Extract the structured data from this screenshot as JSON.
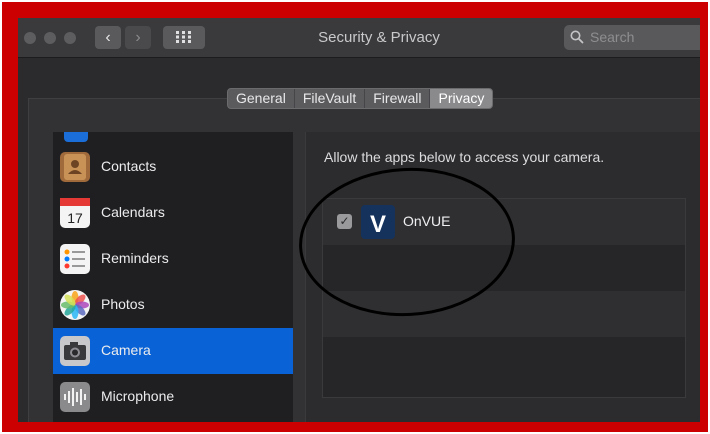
{
  "window": {
    "title": "Security & Privacy",
    "search_placeholder": "Search"
  },
  "tabs": [
    {
      "label": "General",
      "selected": false
    },
    {
      "label": "FileVault",
      "selected": false
    },
    {
      "label": "Firewall",
      "selected": false
    },
    {
      "label": "Privacy",
      "selected": true
    }
  ],
  "sidebar": {
    "items": [
      {
        "label": "Contacts",
        "icon": "contacts-icon",
        "selected": false
      },
      {
        "label": "Calendars",
        "icon": "calendar-icon",
        "icon_text": "17",
        "selected": false
      },
      {
        "label": "Reminders",
        "icon": "reminders-icon",
        "selected": false
      },
      {
        "label": "Photos",
        "icon": "photos-icon",
        "selected": false
      },
      {
        "label": "Camera",
        "icon": "camera-icon",
        "selected": true
      },
      {
        "label": "Microphone",
        "icon": "microphone-icon",
        "selected": false
      }
    ]
  },
  "main": {
    "allow_text": "Allow the apps below to access your camera.",
    "apps": [
      {
        "name": "OnVUE",
        "checked": true,
        "icon": "onvue-app-icon",
        "icon_text": "V"
      }
    ]
  },
  "colors": {
    "frame": "#cc0000",
    "selection": "#0a63d6",
    "window_bg": "#2b2b2d"
  }
}
